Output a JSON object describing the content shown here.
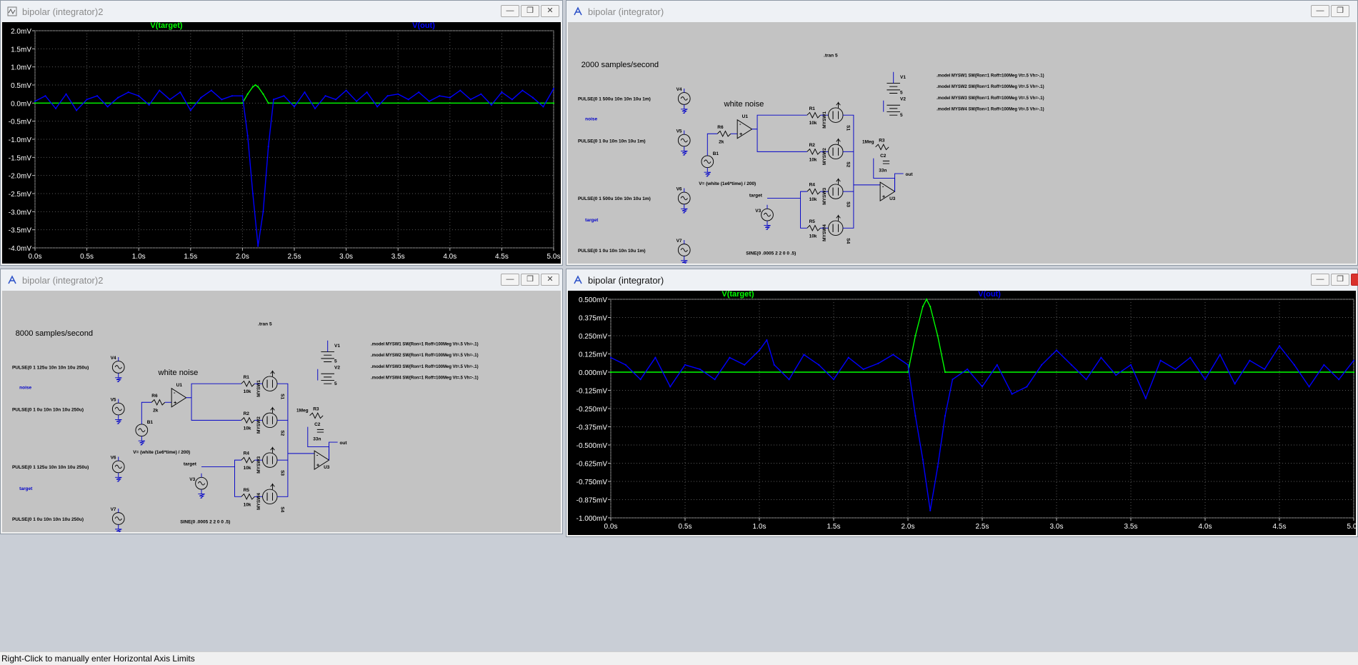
{
  "windows": [
    {
      "id": "w1",
      "title": "bipolar (integrator)2",
      "kind": "plot",
      "active": false,
      "chart": {
        "type": "line",
        "legend": [
          {
            "name": "V(target)",
            "color": "#00ff00"
          },
          {
            "name": "V(out)",
            "color": "#0000ff"
          }
        ],
        "y_ticks": [
          "2.0mV",
          "1.5mV",
          "1.0mV",
          "0.5mV",
          "0.0mV",
          "-0.5mV",
          "-1.0mV",
          "-1.5mV",
          "-2.0mV",
          "-2.5mV",
          "-3.0mV",
          "-3.5mV",
          "-4.0mV"
        ],
        "x_ticks": [
          "0.0s",
          "0.5s",
          "1.0s",
          "1.5s",
          "2.0s",
          "2.5s",
          "3.0s",
          "3.5s",
          "4.0s",
          "4.5s",
          "5.0s"
        ],
        "xlim": [
          0,
          5
        ],
        "ylim": [
          -4.0,
          2.0
        ],
        "series": [
          {
            "name": "V(target)",
            "color": "#00ff00",
            "x": [
              0,
              2.0,
              2.05,
              2.1,
              2.125,
              2.15,
              2.2,
              2.25,
              5.0
            ],
            "y": [
              0,
              0,
              0.25,
              0.45,
              0.5,
              0.45,
              0.25,
              0,
              0
            ]
          },
          {
            "name": "V(out)",
            "color": "#0000ff",
            "x": [
              0,
              0.1,
              0.2,
              0.3,
              0.4,
              0.5,
              0.6,
              0.7,
              0.8,
              0.9,
              1.0,
              1.1,
              1.2,
              1.3,
              1.4,
              1.5,
              1.6,
              1.7,
              1.8,
              1.9,
              2.0,
              2.05,
              2.1,
              2.15,
              2.2,
              2.25,
              2.3,
              2.4,
              2.5,
              2.6,
              2.7,
              2.8,
              2.9,
              3.0,
              3.1,
              3.2,
              3.3,
              3.4,
              3.5,
              3.6,
              3.7,
              3.8,
              3.9,
              4.0,
              4.1,
              4.2,
              4.3,
              4.4,
              4.5,
              4.6,
              4.7,
              4.8,
              4.9,
              5.0
            ],
            "y": [
              0.05,
              0.2,
              -0.15,
              0.25,
              -0.2,
              0.1,
              0.2,
              -0.1,
              0.15,
              0.3,
              0.2,
              -0.05,
              0.35,
              0.1,
              0.3,
              -0.2,
              0.15,
              0.35,
              0.1,
              0.2,
              0.2,
              -0.9,
              -2.5,
              -3.95,
              -3.0,
              -1.2,
              0.1,
              0.2,
              -0.1,
              0.3,
              -0.15,
              0.2,
              0.1,
              0.35,
              0.05,
              0.3,
              -0.1,
              0.2,
              0.25,
              0.1,
              0.3,
              0.05,
              0.2,
              0.15,
              0.35,
              0.1,
              0.25,
              -0.05,
              0.3,
              0.1,
              0.35,
              0.15,
              -0.1,
              0.4
            ]
          }
        ]
      }
    },
    {
      "id": "w2",
      "title": "bipolar (integrator)",
      "kind": "schematic",
      "active": false,
      "schematic": {
        "samples_label": "2000 samples/second",
        "tran": ".tran 5",
        "white_noise": "white noise",
        "noise_label": "noise",
        "target_label": "target",
        "b1_expr": "V= (white (1e6*time) / 200)",
        "sine": "SINE(0 .0005 2 2 0 0 .5)",
        "sources": [
          {
            "ref": "V4",
            "value": "PULSE(0 1 500u 10n 10n 10u 1m)"
          },
          {
            "ref": "V5",
            "value": "PULSE(0 1 0u 10n 10n 10u 1m)"
          },
          {
            "ref": "V6",
            "value": "PULSE(0 1 500u 10n 10n 10u 1m)"
          },
          {
            "ref": "V7",
            "value": "PULSE(0 1 0u 10n 10n 10u 1m)"
          }
        ],
        "models": [
          ".model MYSW1 SW(Ron=1 Roff=100Meg Vt=.5 Vh=-.1)",
          ".model MYSW2 SW(Ron=1 Roff=100Meg Vt=.5 Vh=-.1)",
          ".model MYSW3 SW(Ron=1 Roff=100Meg Vt=.5 Vh=-.1)",
          ".model MYSW4 SW(Ron=1 Roff=100Meg Vt=.5 Vh=-.1)"
        ],
        "parts": {
          "r6": "R6",
          "r6v": "2k",
          "b1": "B1",
          "u1": "U1",
          "u3": "U3",
          "v1": "V1",
          "v2": "V2",
          "five": "5",
          "v3": "V3",
          "r1": "R1",
          "r2": "R2",
          "r4": "R4",
          "r5": "R5",
          "r10k": "10k",
          "r3": "R3",
          "r3v": "1Meg",
          "c2": "C2",
          "c2v": "33n",
          "out": "out",
          "s1": "S1",
          "s2": "S2",
          "s3": "S3",
          "s4": "S4",
          "m1": "MYSW1",
          "m2": "MYSW2",
          "m3": "MYSW3",
          "m4": "MYSW4"
        }
      }
    },
    {
      "id": "w3",
      "title": "bipolar (integrator)2",
      "kind": "schematic",
      "active": false,
      "schematic": {
        "samples_label": "8000 samples/second",
        "tran": ".tran 5",
        "white_noise": "white noise",
        "noise_label": "noise",
        "target_label": "target",
        "b1_expr": "V= (white (1e6*time) / 200)",
        "sine": "SINE(0 .0005 2 2 0 0 .5)",
        "sources": [
          {
            "ref": "V4",
            "value": "PULSE(0 1 125u 10n 10n 10u 250u)"
          },
          {
            "ref": "V5",
            "value": "PULSE(0 1 0u 10n 10n 10u 250u)"
          },
          {
            "ref": "V6",
            "value": "PULSE(0 1 125u 10n 10n 10u 250u)"
          },
          {
            "ref": "V7",
            "value": "PULSE(0 1 0u 10n 10n 10u 250u)"
          }
        ],
        "models": [
          ".model MYSW1 SW(Ron=1 Roff=100Meg Vt=.5 Vh=-.1)",
          ".model MYSW2 SW(Ron=1 Roff=100Meg Vt=.5 Vh=-.1)",
          ".model MYSW3 SW(Ron=1 Roff=100Meg Vt=.5 Vh=-.1)",
          ".model MYSW4 SW(Ron=1 Roff=100Meg Vt=.5 Vh=-.1)"
        ],
        "parts": {
          "r6": "R6",
          "r6v": "2k",
          "b1": "B1",
          "u1": "U1",
          "u3": "U3",
          "v1": "V1",
          "v2": "V2",
          "five": "5",
          "v3": "V3",
          "r1": "R1",
          "r2": "R2",
          "r4": "R4",
          "r5": "R5",
          "r10k": "10k",
          "r3": "R3",
          "r3v": "1Meg",
          "c2": "C2",
          "c2v": "33n",
          "out": "out",
          "s1": "S1",
          "s2": "S2",
          "s3": "S3",
          "s4": "S4",
          "m1": "MYSW1",
          "m2": "MYSW2",
          "m3": "MYSW3",
          "m4": "MYSW4"
        }
      }
    },
    {
      "id": "w4",
      "title": "bipolar (integrator)",
      "kind": "plot",
      "active": true,
      "chart": {
        "type": "line",
        "legend": [
          {
            "name": "V(target)",
            "color": "#00ff00"
          },
          {
            "name": "V(out)",
            "color": "#0000ff"
          }
        ],
        "y_ticks": [
          "0.500mV",
          "0.375mV",
          "0.250mV",
          "0.125mV",
          "0.000mV",
          "-0.125mV",
          "-0.250mV",
          "-0.375mV",
          "-0.500mV",
          "-0.625mV",
          "-0.750mV",
          "-0.875mV",
          "-1.000mV"
        ],
        "x_ticks": [
          "0.0s",
          "0.5s",
          "1.0s",
          "1.5s",
          "2.0s",
          "2.5s",
          "3.0s",
          "3.5s",
          "4.0s",
          "4.5s",
          "5.0s"
        ],
        "xlim": [
          0,
          5
        ],
        "ylim": [
          -1.0,
          0.5
        ],
        "series": [
          {
            "name": "V(target)",
            "color": "#00ff00",
            "x": [
              0,
              2.0,
              2.05,
              2.1,
              2.125,
              2.15,
              2.2,
              2.25,
              5.0
            ],
            "y": [
              0,
              0,
              0.25,
              0.45,
              0.5,
              0.45,
              0.25,
              0,
              0
            ]
          },
          {
            "name": "V(out)",
            "color": "#0000ff",
            "x": [
              0,
              0.1,
              0.2,
              0.3,
              0.4,
              0.5,
              0.6,
              0.7,
              0.8,
              0.9,
              1.0,
              1.05,
              1.1,
              1.2,
              1.3,
              1.4,
              1.5,
              1.6,
              1.7,
              1.8,
              1.9,
              2.0,
              2.05,
              2.1,
              2.15,
              2.2,
              2.25,
              2.3,
              2.4,
              2.5,
              2.6,
              2.7,
              2.8,
              2.9,
              3.0,
              3.1,
              3.2,
              3.3,
              3.4,
              3.5,
              3.6,
              3.7,
              3.8,
              3.9,
              4.0,
              4.1,
              4.2,
              4.3,
              4.4,
              4.5,
              4.6,
              4.7,
              4.8,
              4.9,
              5.0
            ],
            "y": [
              0.1,
              0.05,
              -0.05,
              0.1,
              -0.1,
              0.05,
              0.02,
              -0.05,
              0.1,
              0.05,
              0.15,
              0.22,
              0.05,
              -0.05,
              0.12,
              0.05,
              -0.05,
              0.1,
              0.02,
              0.06,
              0.12,
              0.05,
              -0.3,
              -0.6,
              -0.95,
              -0.65,
              -0.3,
              -0.05,
              0.02,
              -0.1,
              0.05,
              -0.15,
              -0.1,
              0.05,
              0.15,
              0.05,
              -0.05,
              0.1,
              -0.02,
              0.05,
              -0.18,
              0.08,
              0.02,
              0.1,
              -0.05,
              0.12,
              -0.08,
              0.08,
              0.02,
              0.18,
              0.05,
              -0.1,
              0.05,
              -0.05,
              0.08
            ]
          }
        ]
      }
    }
  ],
  "status_bar": {
    "text": "Right-Click to manually enter Horizontal Axis Limits"
  }
}
